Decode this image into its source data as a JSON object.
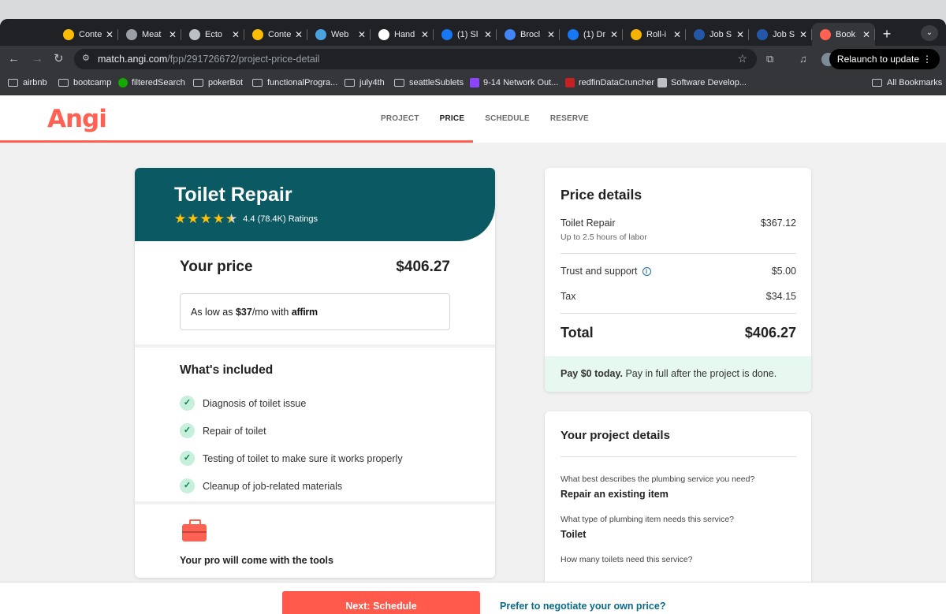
{
  "browser": {
    "tabs": [
      {
        "title": "Conte",
        "icon": "chrome-icon",
        "color": "#fbbc05"
      },
      {
        "title": "Meat",
        "icon": "globe-icon",
        "color": "#9aa0a6"
      },
      {
        "title": "Ecto",
        "icon": "chatgpt-icon",
        "color": "#bdc1c6"
      },
      {
        "title": "Conte",
        "icon": "chrome-icon",
        "color": "#fbbc05"
      },
      {
        "title": "Web",
        "icon": "window-icon",
        "color": "#4aa3df"
      },
      {
        "title": "Hand",
        "icon": "info-icon",
        "color": "#ffffff"
      },
      {
        "title": "(1) Sl",
        "icon": "facebook-icon",
        "color": "#1877f2"
      },
      {
        "title": "Brocl",
        "icon": "docs-icon",
        "color": "#4285f4"
      },
      {
        "title": "(1) Dr",
        "icon": "facebook-icon",
        "color": "#1877f2"
      },
      {
        "title": "Roll-i",
        "icon": "slides-icon",
        "color": "#f4b400"
      },
      {
        "title": "Job S",
        "icon": "indeed-icon",
        "color": "#2557a7"
      },
      {
        "title": "Job S",
        "icon": "indeed-icon",
        "color": "#2557a7"
      },
      {
        "title": "Book",
        "icon": "angi-icon",
        "color": "#ff6153"
      }
    ],
    "url_host": "match.angi.com",
    "url_path": "/fpp/291726672/project-price-detail",
    "relaunch_label": "Relaunch to update",
    "bookmarks": [
      {
        "label": "airbnb",
        "icon": "folder-icon"
      },
      {
        "label": "bootcamp",
        "icon": "folder-icon"
      },
      {
        "label": "filteredSearch",
        "icon": "upwork-icon"
      },
      {
        "label": "pokerBot",
        "icon": "folder-icon"
      },
      {
        "label": "functionalProgra...",
        "icon": "folder-icon"
      },
      {
        "label": "july4th",
        "icon": "folder-icon"
      },
      {
        "label": "seattleSublets",
        "icon": "folder-icon"
      },
      {
        "label": "9-14 Network Out...",
        "icon": "stack-icon"
      },
      {
        "label": "redfinDataCruncher",
        "icon": "redfin-icon"
      },
      {
        "label": "Software Develop...",
        "icon": "chart-icon"
      }
    ],
    "all_bookmarks_label": "All Bookmarks"
  },
  "site": {
    "logo": "Angi",
    "steps": [
      "PROJECT",
      "PRICE",
      "SCHEDULE",
      "RESERVE"
    ],
    "active_step": "PRICE",
    "progress_fraction": 0.5
  },
  "service": {
    "title": "Toilet Repair",
    "rating_value": 4.4,
    "rating_text": "4.4 (78.4K) Ratings",
    "your_price_label": "Your price",
    "your_price": "$406.27",
    "affirm_prefix": "As low as ",
    "affirm_amount": "$37",
    "affirm_suffix": "/mo with ",
    "affirm_brand": "affirm",
    "included_title": "What's included",
    "included": [
      "Diagnosis of toilet issue",
      "Repair of toilet",
      "Testing of toilet to make sure it works properly",
      "Cleanup of job-related materials"
    ],
    "tools_text": "Your pro will come with the tools"
  },
  "price_details": {
    "title": "Price details",
    "line_item": "Toilet Repair",
    "line_item_note": "Up to 2.5 hours of labor",
    "line_item_price": "$367.12",
    "trust_label": "Trust and support",
    "trust_price": "$5.00",
    "tax_label": "Tax",
    "tax_price": "$34.15",
    "total_label": "Total",
    "total_price": "$406.27",
    "pay_bold": "Pay $0 today.",
    "pay_rest": " Pay in full after the project is done."
  },
  "project_details": {
    "title": "Your project details",
    "qa": [
      {
        "q": "What best describes the plumbing service you need?",
        "a": "Repair an existing item"
      },
      {
        "q": "What type of plumbing item needs this service?",
        "a": "Toilet"
      },
      {
        "q": "How many toilets need this service?",
        "a": ""
      }
    ]
  },
  "footer": {
    "next_label": "Next: Schedule",
    "negotiate_label": "Prefer to negotiate your own price?"
  }
}
